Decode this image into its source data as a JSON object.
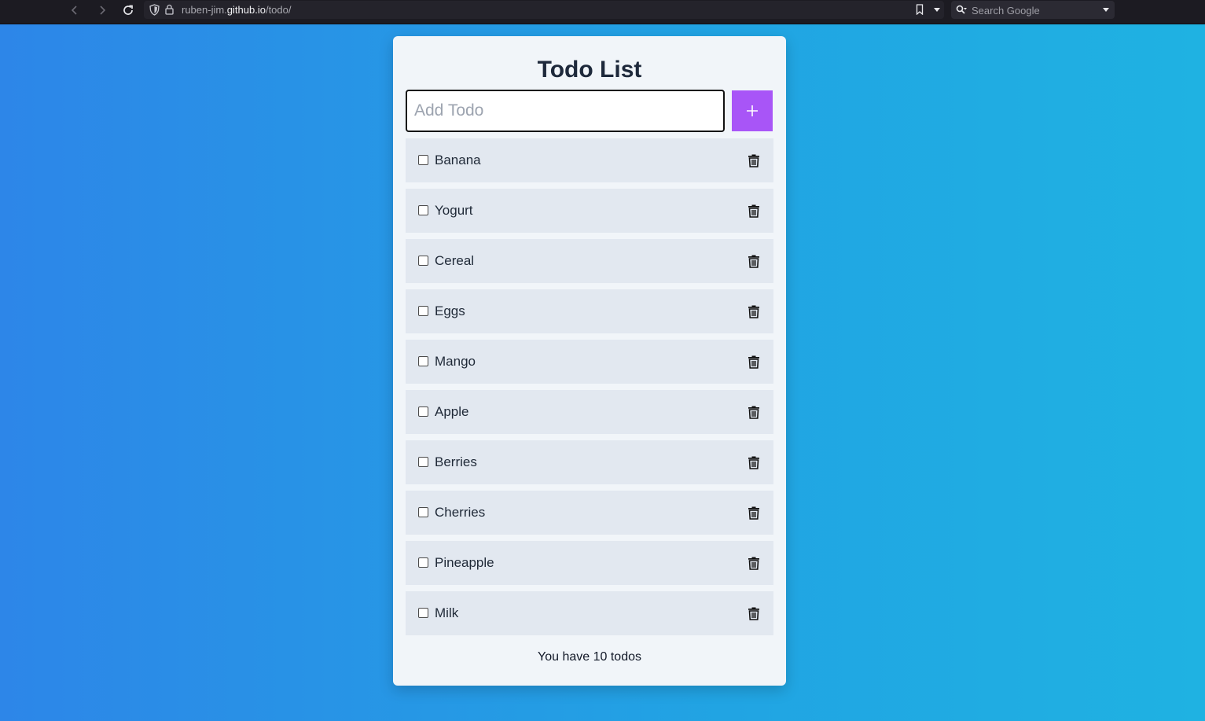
{
  "browser": {
    "url_prefix": "ruben-jim.",
    "url_domain": "github.io",
    "url_path": "/todo/",
    "search_placeholder": "Search Google"
  },
  "app": {
    "title": "Todo List",
    "input_placeholder": "Add Todo",
    "add_button_symbol": "+",
    "accent_color": "#a855f7"
  },
  "todos": [
    {
      "label": "Banana",
      "done": false
    },
    {
      "label": "Yogurt",
      "done": false
    },
    {
      "label": "Cereal",
      "done": false
    },
    {
      "label": "Eggs",
      "done": false
    },
    {
      "label": "Mango",
      "done": false
    },
    {
      "label": "Apple",
      "done": false
    },
    {
      "label": "Berries",
      "done": false
    },
    {
      "label": "Cherries",
      "done": false
    },
    {
      "label": "Pineapple",
      "done": false
    },
    {
      "label": "Milk",
      "done": false
    }
  ],
  "footer": {
    "count_text": "You have 10 todos"
  }
}
